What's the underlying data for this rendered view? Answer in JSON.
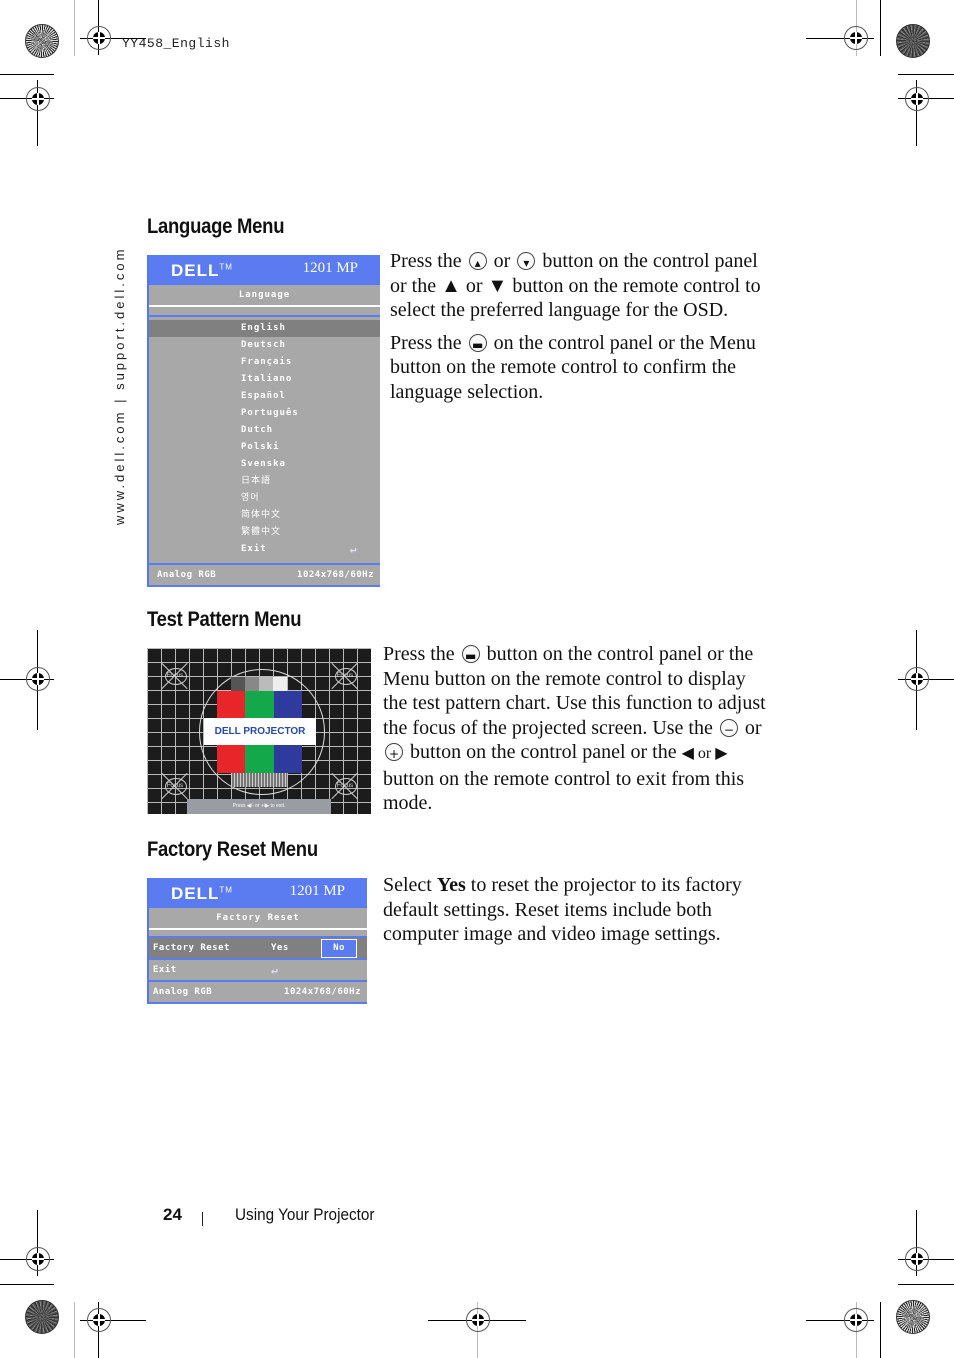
{
  "header": {
    "job_id": "YY458_English"
  },
  "side_url": "www.dell.com | support.dell.com",
  "sections": {
    "language": {
      "heading": "Language Menu",
      "paragraphs": {
        "p1": {
          "t1": "Press the",
          "icon1": "up-button-icon",
          "t2": "or",
          "icon2": "down-button-icon",
          "t3": "button on the control panel or the ▲ or ▼ button on the remote control to select the preferred language for the OSD."
        },
        "p2": {
          "t1": "Press the",
          "icon1": "menu-button-icon",
          "t2": "on the control panel or the Menu button on the remote control to confirm the language selection."
        }
      },
      "osd": {
        "brand": "DELL",
        "trademark": "TM",
        "model": "1201 MP",
        "title": "Language",
        "items": [
          "English",
          "Deutsch",
          "Français",
          "Italiano",
          "Español",
          "Português",
          "Dutch",
          "Polski",
          "Svenska",
          "日本語",
          "영어",
          "简体中文",
          "繁體中文",
          "Exit"
        ],
        "selected": "English",
        "exit_icon": "return-arrow-icon",
        "footer_source": "Analog RGB",
        "footer_resolution": "1024x768/60Hz",
        "colors": {
          "header": "#5b7cf0",
          "body": "#a8a8a8",
          "selected": "#808080"
        }
      }
    },
    "test_pattern": {
      "heading": "Test Pattern Menu",
      "paragraph": {
        "t1": "Press the",
        "icon1": "menu-button-icon",
        "t2": "button on the control panel or the Menu button on the remote control to display the test pattern chart. Use this function to adjust the focus of the projected screen. Use the",
        "icon2": "minus-button-icon",
        "t3": "or",
        "icon3": "plus-button-icon",
        "t4": "button on the control panel or the",
        "t5": "◀ or ▶",
        "t6": "button on the remote control to exit from this mode."
      },
      "pattern": {
        "label": "DELL  PROJECTOR",
        "focus_label": "Focus",
        "exit_hint": "Press  ◀/- or +/▶  to exit.",
        "colors": {
          "red": "#e8262a",
          "green": "#13a84a",
          "blue": "#2e3a9c"
        }
      }
    },
    "factory_reset": {
      "heading": "Factory Reset Menu",
      "paragraph": {
        "t1": "Select",
        "bold": "Yes",
        "t2": "to reset the projector to its factory default settings. Reset items include both computer image and video image settings."
      },
      "osd": {
        "brand": "DELL",
        "trademark": "TM",
        "model": "1201 MP",
        "title": "Factory Reset",
        "row_label": "Factory Reset",
        "yes": "Yes",
        "no": "No",
        "selected": "No",
        "exit": "Exit",
        "exit_icon": "return-arrow-icon",
        "footer_source": "Analog RGB",
        "footer_resolution": "1024x768/60Hz"
      }
    }
  },
  "footer": {
    "page_number": "24",
    "chapter": "Using Your Projector"
  }
}
